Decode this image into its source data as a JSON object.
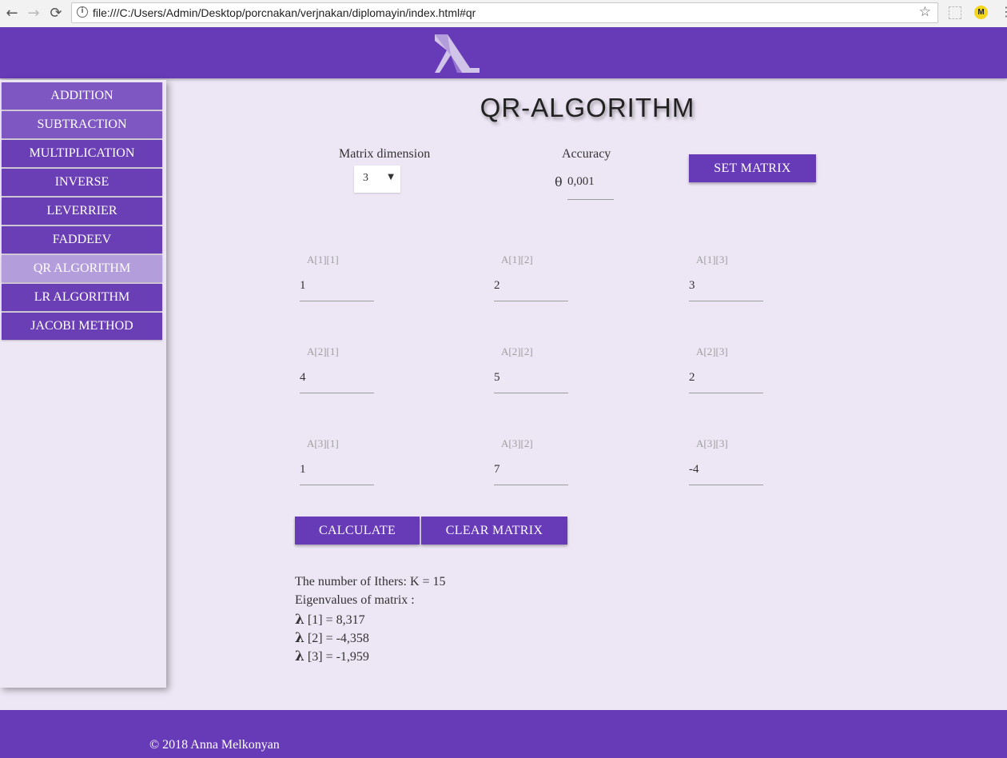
{
  "browser": {
    "url": "file:///C:/Users/Admin/Desktop/porcnakan/verjnakan/diplomayin/index.html#qr",
    "back_icon": "←",
    "forward_icon": "→",
    "reload_icon": "⟳",
    "info_icon": "i",
    "star_icon": "☆",
    "ext_icon": "M",
    "menu_icon": "⋮"
  },
  "colors": {
    "primary": "#673ab7",
    "sidebar_item": "#7e57c2",
    "active_item": "#b39ddb",
    "background": "#ede6f5"
  },
  "sidebar": {
    "items": [
      {
        "label": "ADDITION"
      },
      {
        "label": "SUBTRACTION"
      },
      {
        "label": "MULTIPLICATION"
      },
      {
        "label": "INVERSE"
      },
      {
        "label": "LEVERRIER"
      },
      {
        "label": "FADDEEV"
      },
      {
        "label": "QR ALGORITHM"
      },
      {
        "label": "LR ALGORITHM"
      },
      {
        "label": "JACOBI METHOD"
      }
    ],
    "active": "QR ALGORITHM"
  },
  "main": {
    "title": "QR-ALGORITHM",
    "dimension_label": "Matrix dimension",
    "dimension_value": "3",
    "accuracy_label": "Accuracy",
    "accuracy_symbol": "θ",
    "accuracy_value": "0,001",
    "set_matrix_label": "SET MATRIX",
    "matrix": {
      "labels": [
        [
          "A[1][1]",
          "A[1][2]",
          "A[1][3]"
        ],
        [
          "A[2][1]",
          "A[2][2]",
          "A[2][3]"
        ],
        [
          "A[3][1]",
          "A[3][2]",
          "A[3][3]"
        ]
      ],
      "values": [
        [
          "1",
          "2",
          "3"
        ],
        [
          "4",
          "5",
          "2"
        ],
        [
          "1",
          "7",
          "-4"
        ]
      ]
    },
    "calculate_label": "CALCULATE",
    "clear_label": "CLEAR MATRIX",
    "results": {
      "iterations": "The number of Ithers: K = 15",
      "eigen_header": "Eigenvalues of matrix :",
      "lambda": "λ",
      "eigenvalues": [
        "[1] = 8,317",
        "[2] = -4,358",
        "[3] = -1,959"
      ]
    }
  },
  "footer": {
    "copyright": "© 2018 Anna Melkonyan"
  }
}
